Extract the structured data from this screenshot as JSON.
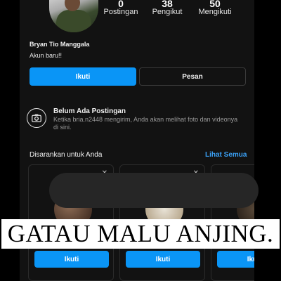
{
  "profile": {
    "name": "Bryan Tio Manggala",
    "bio": "Akun baru!!"
  },
  "stats": [
    {
      "value": "0",
      "label": "Postingan"
    },
    {
      "value": "38",
      "label": "Pengikut"
    },
    {
      "value": "50",
      "label": "Mengikuti"
    }
  ],
  "actions": {
    "follow_label": "Ikuti",
    "message_label": "Pesan"
  },
  "no_posts": {
    "title": "Belum Ada Postingan",
    "description": "Ketika bria.n2448 mengirim, Anda akan melihat foto dan videonya di sini.",
    "icon": "camera-icon"
  },
  "suggestions": {
    "title": "Disarankan untuk Anda",
    "see_all_label": "Lihat Semua",
    "cards": [
      {
        "button_label": "Ikuti"
      },
      {
        "button_label": "Ikuti"
      },
      {
        "button_label": "Ikuti"
      }
    ]
  },
  "overlay_caption": "GATAU MALU ANJING.",
  "colors": {
    "accent": "#0a95f6",
    "link": "#3aa0f5",
    "background": "#121212"
  }
}
